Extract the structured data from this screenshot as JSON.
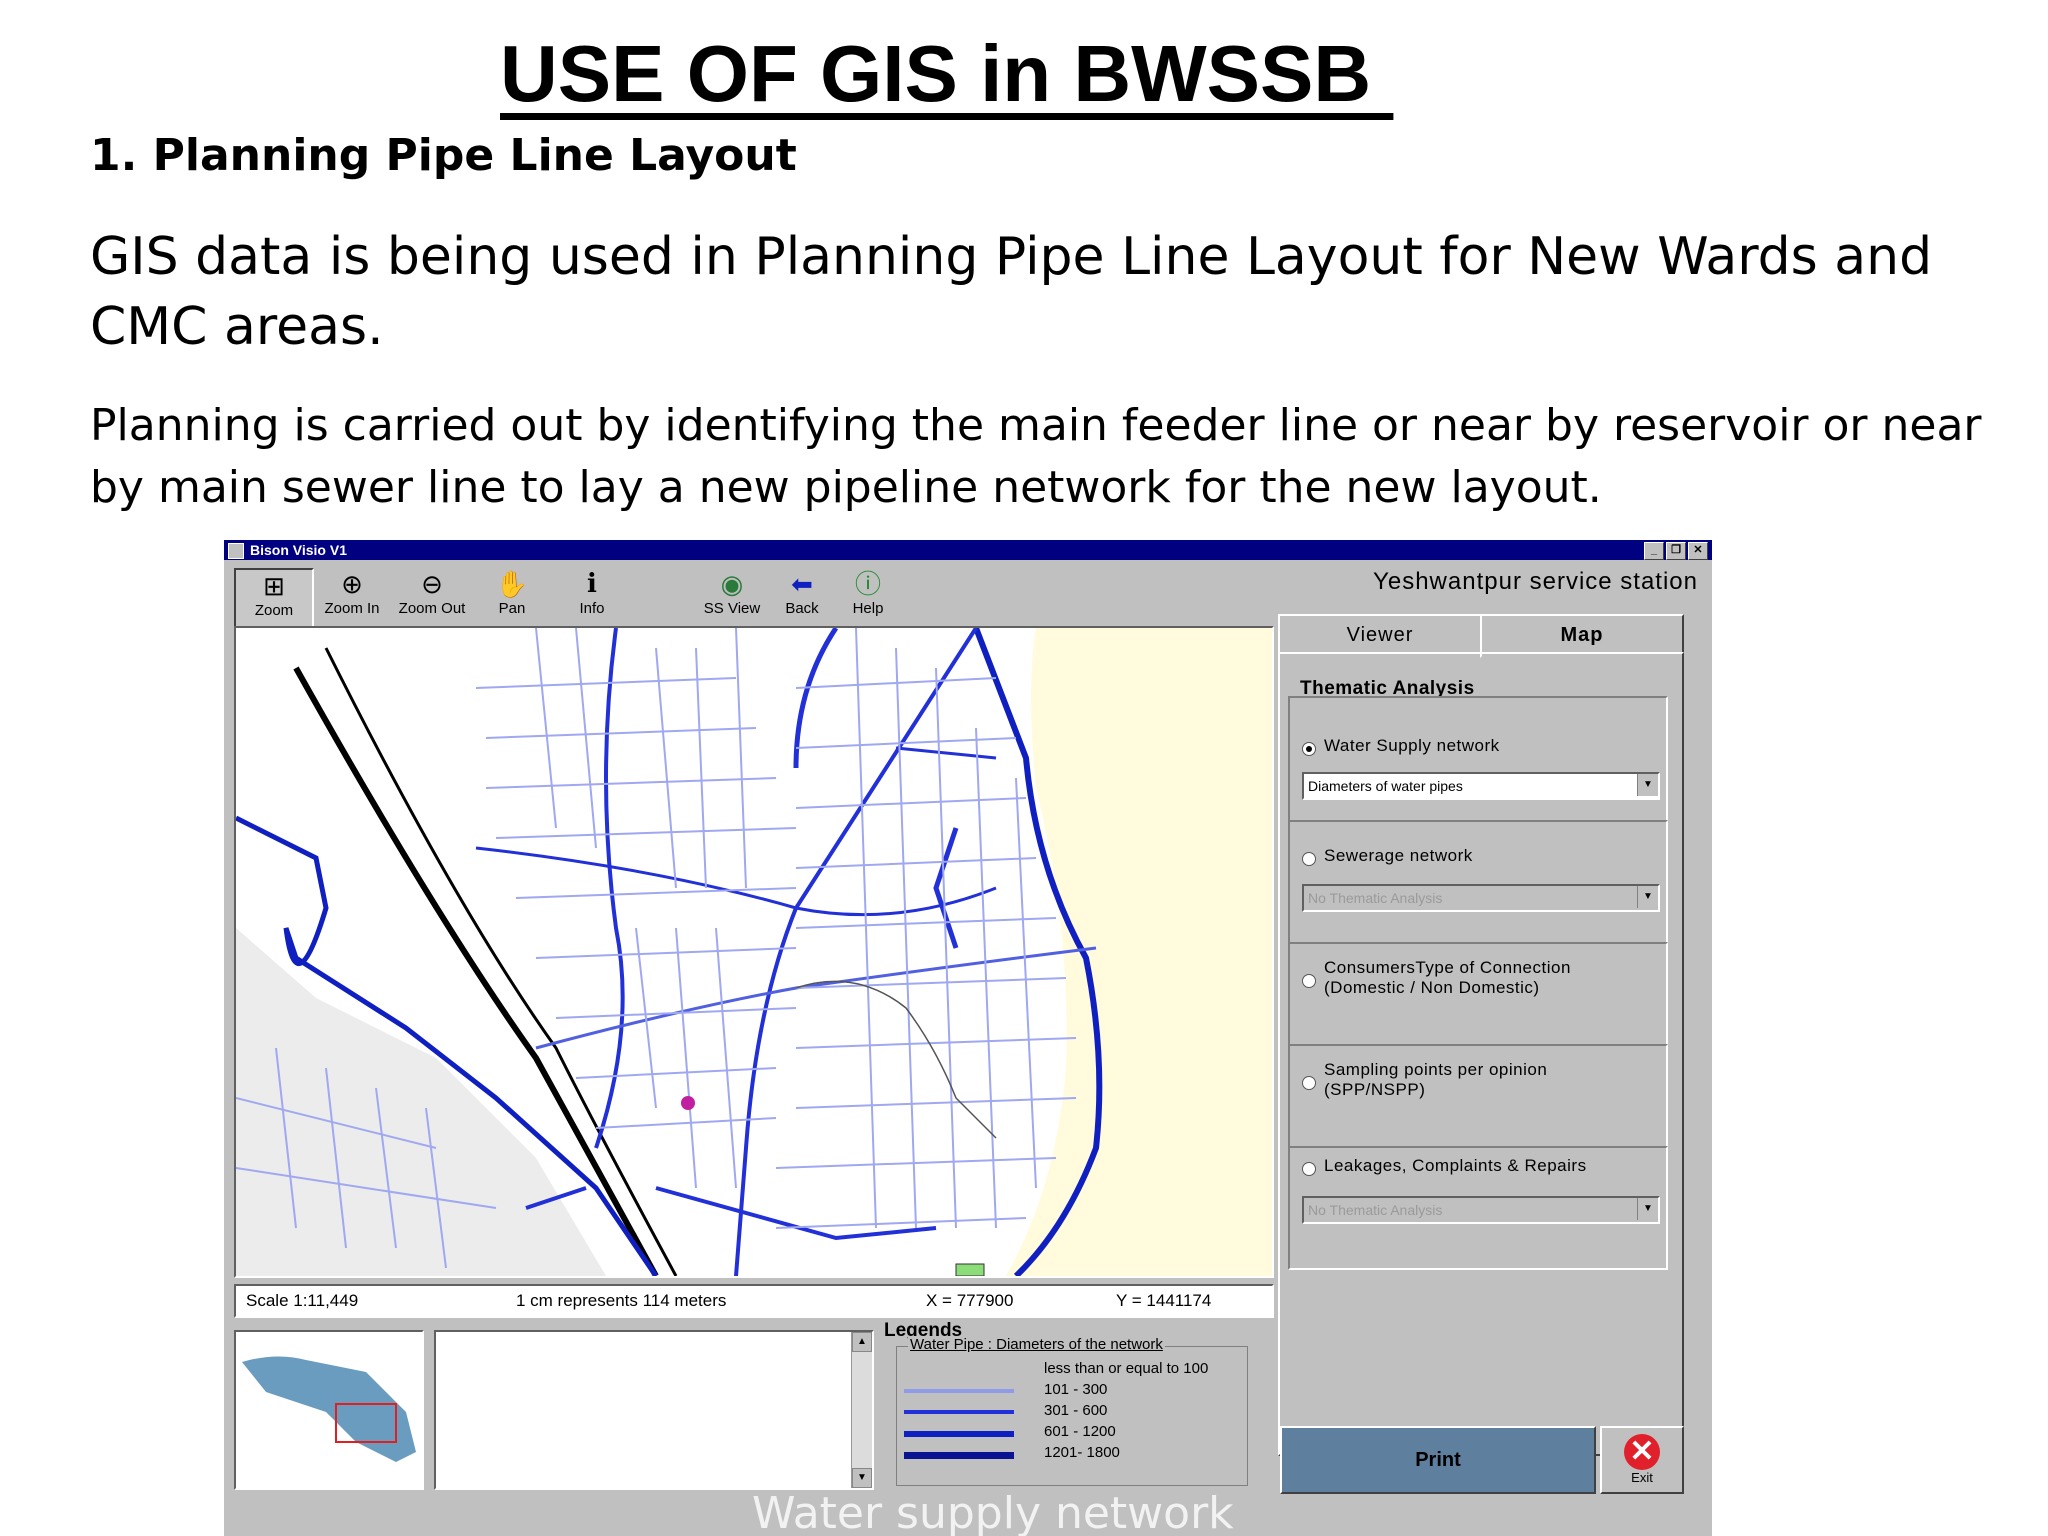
{
  "slide": {
    "title": "USE OF GIS in BWSSB ",
    "heading": "1. Planning Pipe Line Layout",
    "paragraph1": "GIS data is being used in Planning Pipe Line Layout for New Wards and CMC areas.",
    "paragraph2": "Planning is carried out by identifying the main feeder line or near by reservoir or near by main sewer line  to lay a new pipeline network for the new layout."
  },
  "app": {
    "window_title": "Bison Visio V1",
    "toolbar": {
      "zoom": "Zoom",
      "zoom_in": "Zoom In",
      "zoom_out": "Zoom Out",
      "pan": "Pan",
      "info": "Info",
      "ss_view": "SS View",
      "back": "Back",
      "help": "Help"
    },
    "station": "Yeshwantpur service station",
    "status": {
      "scale": "Scale 1:11,449",
      "represents": "1 cm represents 114 meters",
      "x": "X = 777900",
      "y": "Y = 1441174"
    },
    "legends": {
      "title": "Legends",
      "subtitle": "Water Pipe : Diameters of the network",
      "items": [
        {
          "label": "less than or equal to 100",
          "color": "#9fa8f0"
        },
        {
          "label": "101 - 300",
          "color": "#8f9ae8"
        },
        {
          "label": "301 - 600",
          "color": "#2230d8"
        },
        {
          "label": "601 - 1200",
          "color": "#1020c0"
        },
        {
          "label": "1201- 1800",
          "color": "#0a1490"
        }
      ]
    },
    "caption": "Water supply network",
    "tabs": {
      "viewer": "Viewer",
      "map": "Map"
    },
    "panel": {
      "title": "Thematic Analysis",
      "water_supply": "Water Supply network",
      "water_supply_select": "Diameters of water pipes",
      "sewerage": "Sewerage network",
      "sewerage_select": "No Thematic Analysis",
      "consumers_line1": "ConsumersType of Connection",
      "consumers_line2": "(Domestic / Non Domestic)",
      "sampling_line1": "Sampling points per opinion",
      "sampling_line2": "(SPP/NSPP)",
      "leakages": "Leakages, Complaints & Repairs",
      "leakages_select": "No Thematic Analysis"
    },
    "buttons": {
      "print": "Print",
      "exit": "Exit"
    }
  }
}
